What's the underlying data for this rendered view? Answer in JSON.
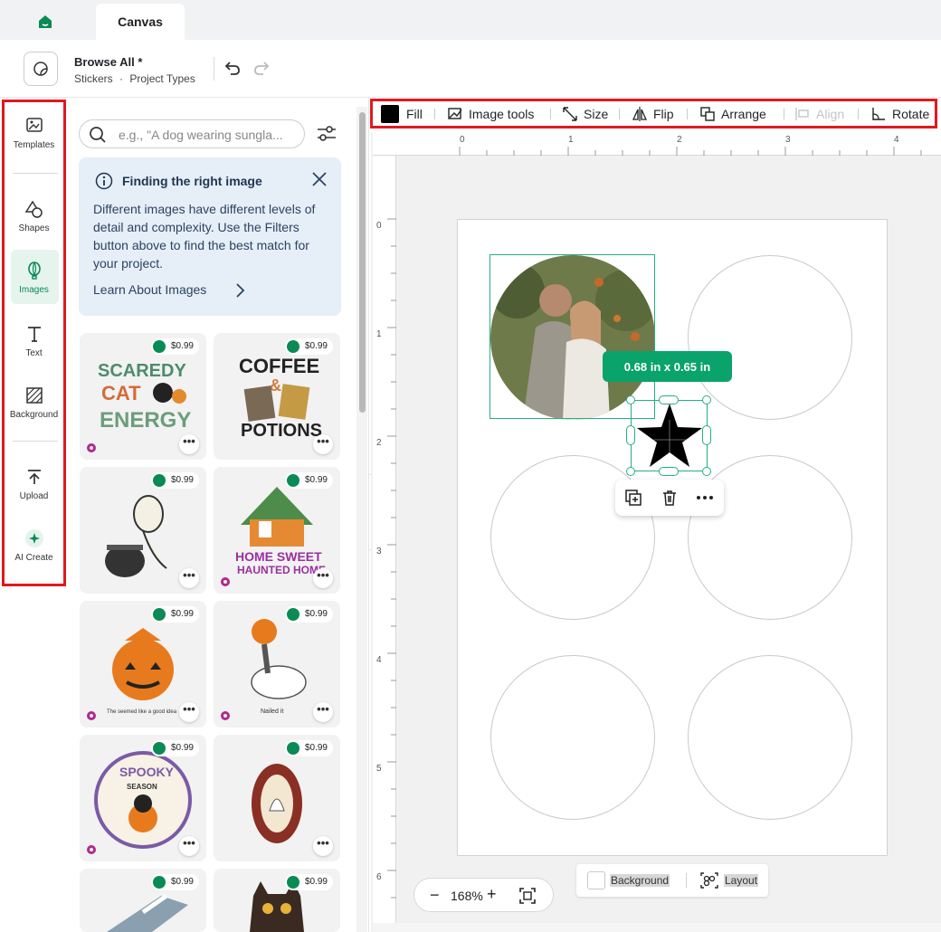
{
  "tabs": {
    "home_icon": "home-icon",
    "canvas": "Canvas"
  },
  "header": {
    "title": "Browse All *",
    "crumb_1": "Stickers",
    "crumb_sep": "·",
    "crumb_2": "Project Types"
  },
  "rail": {
    "templates": "Templates",
    "shapes": "Shapes",
    "images": "Images",
    "text": "Text",
    "background": "Background",
    "upload": "Upload",
    "ai_create": "AI Create"
  },
  "panel": {
    "search_placeholder": "e.g., \"A dog wearing sungla...",
    "info_title": "Finding the right image",
    "info_body": "Different images have different levels of detail and complexity. Use the Filters button above to find the best match for your project.",
    "info_link": "Learn About Images",
    "tiles": [
      {
        "price": "$0.99",
        "art_text_1": "SCAREDY",
        "art_text_2": "CAT",
        "art_text_3": "ENERGY"
      },
      {
        "price": "$0.99",
        "art_text_1": "COFFEE",
        "art_text_2": "&",
        "art_text_3": "POTIONS"
      },
      {
        "price": "$0.99"
      },
      {
        "price": "$0.99",
        "art_text_1": "HOME SWEET",
        "art_text_2": "HAUNTED HOME"
      },
      {
        "price": "$0.99",
        "art_text_1": "The seemed like a good idea"
      },
      {
        "price": "$0.99",
        "art_text_1": "Nailed it"
      },
      {
        "price": "$0.99",
        "art_text_1": "SPOOKY",
        "art_text_2": "SEASON"
      },
      {
        "price": "$0.99"
      },
      {
        "price": "$0.99"
      },
      {
        "price": "$0.99"
      }
    ],
    "more_label": "•••"
  },
  "toolbar": {
    "fill": "Fill",
    "image_tools": "Image tools",
    "size": "Size",
    "flip": "Flip",
    "arrange": "Arrange",
    "align": "Align",
    "rotate": "Rotate"
  },
  "canvas": {
    "size_badge": "0.68  in x 0.65  in",
    "ruler_top": [
      "0",
      "1",
      "2",
      "3",
      "4"
    ],
    "ruler_left": [
      "0",
      "1",
      "2",
      "3",
      "4",
      "5",
      "6"
    ]
  },
  "zoom": {
    "minus": "−",
    "value": "168%",
    "plus": "+"
  },
  "bottom": {
    "background": "Background",
    "layout": "Layout"
  },
  "colors": {
    "accent": "#0aa36b",
    "highlight_border": "#e0191e",
    "info_bg": "#e6eef8"
  }
}
